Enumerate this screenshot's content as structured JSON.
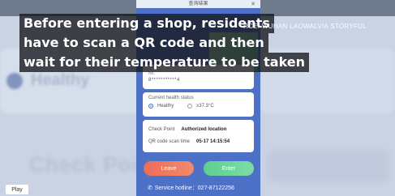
{
  "app": {
    "title": "查询结果"
  },
  "caption": {
    "line1": "Before entering a shop, residents",
    "line2": "have to scan a QR code and then",
    "line3": "wait for their temperature to be taken"
  },
  "source": "RCE: WUHAN LAOWALVIA STORYFUL",
  "id_card": {
    "no_label": "No.",
    "phone": "8***********4"
  },
  "health": {
    "title": "Current health status",
    "options": [
      {
        "label": "Healthy",
        "selected": true
      },
      {
        "label": "≥37.3°C",
        "selected": false
      }
    ]
  },
  "checkpoint": {
    "label": "Check Point",
    "value": "Authorized location",
    "scan_label": "QR code scan time",
    "scan_value": "05-17 14:15:54"
  },
  "buttons": {
    "leave": "Leave",
    "enter": "Enter"
  },
  "hotline": "Service hotline：027-87122256",
  "background": {
    "healthy": "Healthy",
    "checkpoint": "Check Point"
  },
  "player": {
    "play_label": "Play"
  },
  "colors": {
    "phone_blue": "#4d71c7",
    "leave": "#ee6d58",
    "enter": "#5dd08f"
  }
}
